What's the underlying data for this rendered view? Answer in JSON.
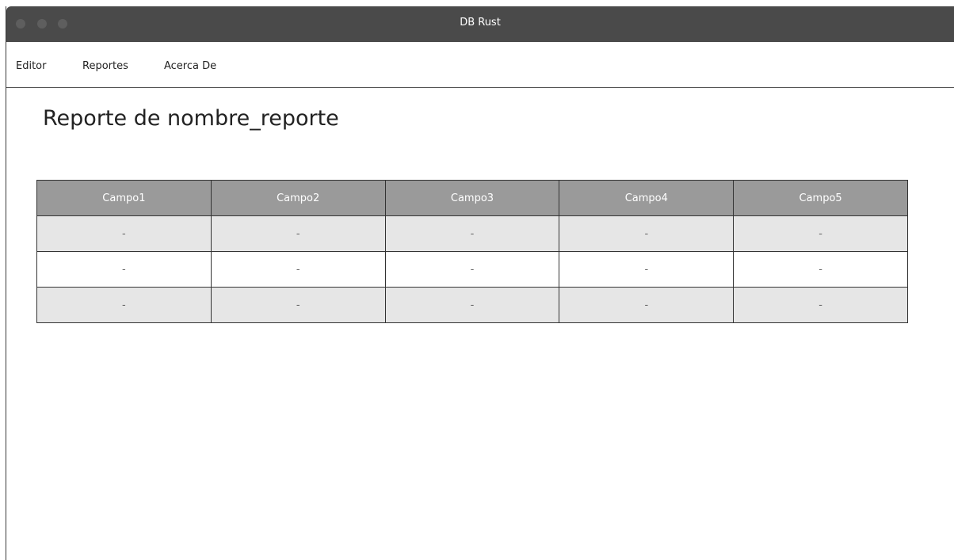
{
  "window": {
    "title": "DB Rust"
  },
  "menu": {
    "items": [
      {
        "label": "Editor"
      },
      {
        "label": "Reportes"
      },
      {
        "label": "Acerca De"
      }
    ]
  },
  "page": {
    "title": "Reporte de nombre_reporte"
  },
  "table": {
    "columns": [
      "Campo1",
      "Campo2",
      "Campo3",
      "Campo4",
      "Campo5"
    ],
    "rows": [
      [
        "-",
        "-",
        "-",
        "-",
        "-"
      ],
      [
        "-",
        "-",
        "-",
        "-",
        "-"
      ],
      [
        "-",
        "-",
        "-",
        "-",
        "-"
      ]
    ]
  },
  "colors": {
    "titlebar": "#4a4a4a",
    "header": "#9a9a9a",
    "row_shade": "#e6e6e6"
  }
}
